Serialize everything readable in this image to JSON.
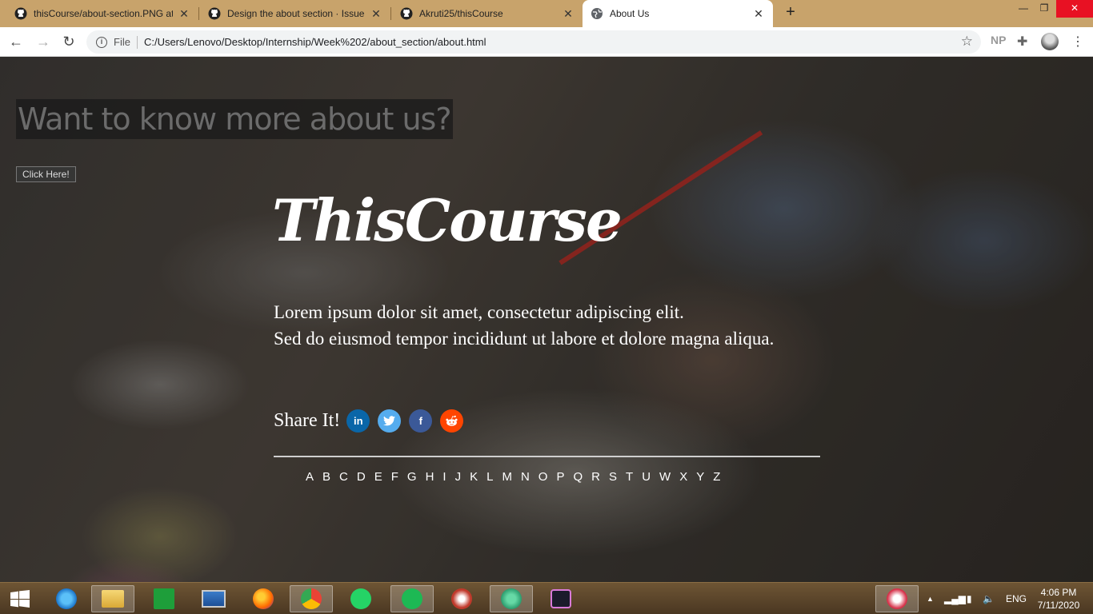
{
  "browser": {
    "tabs": [
      {
        "title": "thisCourse/about-section.PNG at",
        "active": false,
        "icon": "github-icon"
      },
      {
        "title": "Design the about section · Issue",
        "active": false,
        "icon": "github-icon"
      },
      {
        "title": "Akruti25/thisCourse",
        "active": false,
        "icon": "github-icon"
      },
      {
        "title": "About Us",
        "active": true,
        "icon": "globe-icon"
      }
    ],
    "address": {
      "scheme_label": "File",
      "url": "C:/Users/Lenovo/Desktop/Internship/Week%202/about_section/about.html"
    },
    "profile_initials": "NP"
  },
  "page": {
    "headline": "Want to know more about us?",
    "cta_button": "Click Here!",
    "brand": "ThisCourse",
    "description": {
      "line1": "Lorem ipsum dolor sit amet, consectetur adipiscing elit.",
      "line2": "Sed do eiusmod tempor incididunt ut labore et dolore magna aliqua."
    },
    "share_label": "Share It!",
    "social": [
      {
        "name": "linkedin",
        "glyph": "in",
        "color": "#0a66a8"
      },
      {
        "name": "twitter",
        "glyph": "🐦",
        "color": "#55acee"
      },
      {
        "name": "facebook",
        "glyph": "f",
        "color": "#3b5998"
      },
      {
        "name": "reddit",
        "glyph": "◉",
        "color": "#ff4500"
      }
    ],
    "alphabet": [
      "A",
      "B",
      "C",
      "D",
      "E",
      "F",
      "G",
      "H",
      "I",
      "J",
      "K",
      "L",
      "M",
      "N",
      "O",
      "P",
      "Q",
      "R",
      "S",
      "T",
      "U",
      "W",
      "X",
      "Y",
      "Z"
    ]
  },
  "taskbar": {
    "tray_lang": "ENG",
    "time": "4:06 PM",
    "date": "7/11/2020"
  }
}
